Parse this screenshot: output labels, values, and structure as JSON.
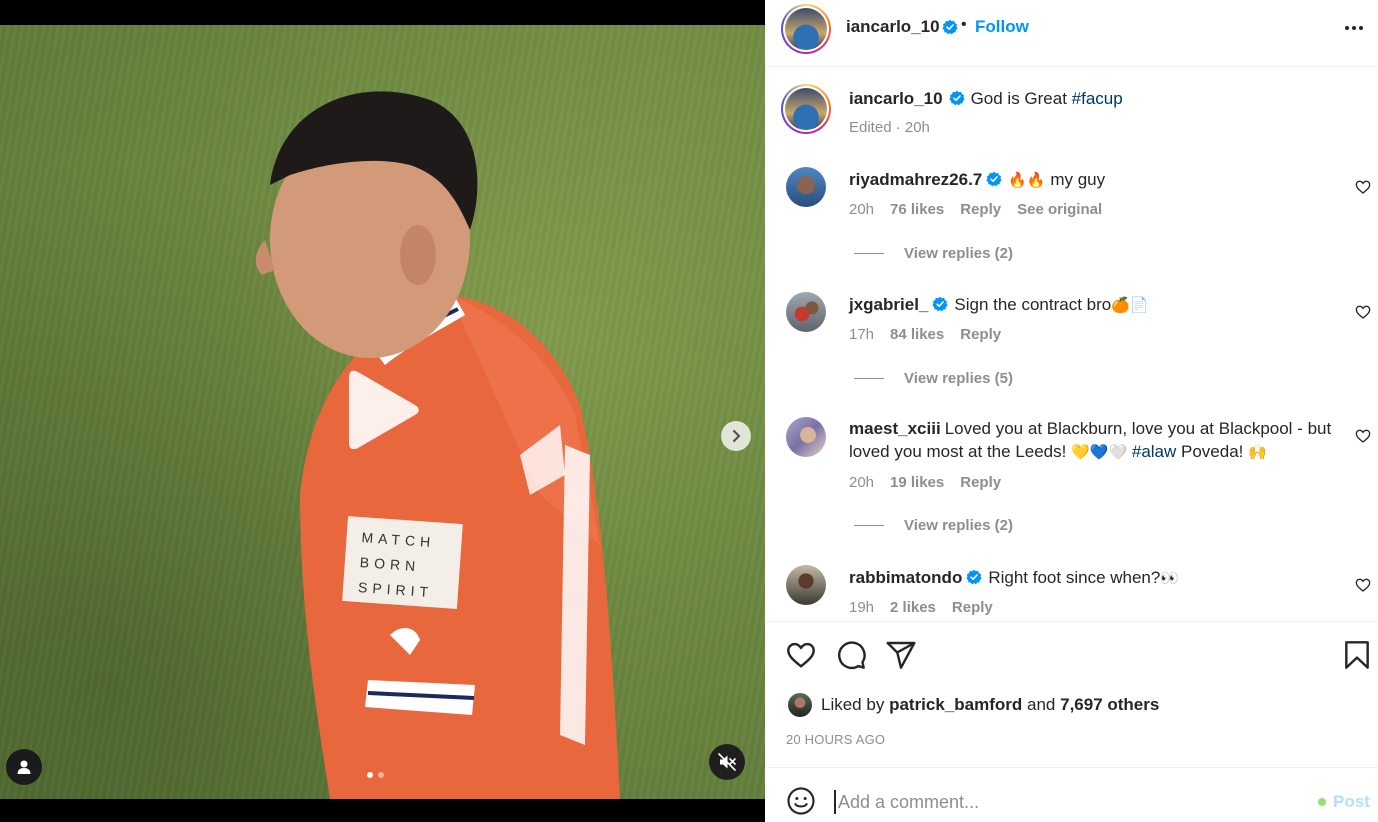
{
  "post": {
    "author": "iancarlo_10",
    "follow_label": "Follow",
    "separator": "•",
    "caption_text": "God is Great",
    "caption_hashtag": "#facup",
    "caption_meta": "Edited · 20h"
  },
  "media": {
    "slide_count": 2,
    "active_slide": 1
  },
  "comments": [
    {
      "username": "riyadmahrez26.7",
      "verified": true,
      "text_emoji": "🔥🔥",
      "text": "my guy",
      "time": "20h",
      "likes": "76 likes",
      "reply_label": "Reply",
      "extra_label": "See original",
      "replies_label": "View replies (2)"
    },
    {
      "username": "jxgabriel_",
      "verified": true,
      "text": "Sign the contract bro",
      "text_emoji": "🍊📄",
      "time": "17h",
      "likes": "84 likes",
      "reply_label": "Reply",
      "replies_label": "View replies (5)"
    },
    {
      "username": "maest_xciii",
      "verified": false,
      "text_line1": "Loved you at Blackburn, love you at Blackpool - but",
      "text_line2a": "loved you most at the Leeds!",
      "text_emoji": "💛💙🤍",
      "hashtag": "#alaw",
      "text_line2b": "Poveda!",
      "text_emoji2": "🙌",
      "time": "20h",
      "likes": "19 likes",
      "reply_label": "Reply",
      "replies_label": "View replies (2)"
    },
    {
      "username": "rabbimatondo",
      "verified": true,
      "text": "Right foot since when?",
      "text_emoji": "👀",
      "time": "19h",
      "likes": "2 likes",
      "reply_label": "Reply"
    }
  ],
  "likes": {
    "prefix": "Liked by",
    "user": "patrick_bamford",
    "joiner": "and",
    "others": "7,697 others"
  },
  "timestamp": "20 HOURS AGO",
  "composer": {
    "placeholder": "Add a comment...",
    "post_label": "Post"
  },
  "colors": {
    "accent": "#0095f6",
    "text": "#262626",
    "muted": "#8e8e8e",
    "hashtag": "#00376b"
  },
  "icons": [
    "verified-badge-icon",
    "more-options-icon",
    "play-icon",
    "next-arrow-icon",
    "user-tag-icon",
    "mute-icon",
    "heart-icon",
    "comment-icon",
    "share-icon",
    "bookmark-icon",
    "emoji-icon"
  ]
}
